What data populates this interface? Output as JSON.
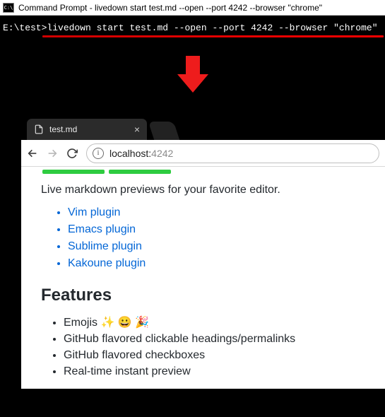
{
  "cmd": {
    "title": "Command Prompt - livedown  start test.md --open --port 4242 --browser \"chrome\"",
    "prompt": "E:\\test>",
    "command": "livedown start test.md --open --port 4242 --browser \"chrome\""
  },
  "browser": {
    "tab_title": "test.md",
    "address_host": "localhost:",
    "address_port": "4242"
  },
  "page": {
    "intro": "Live markdown previews for your favorite editor.",
    "plugins": [
      "Vim plugin",
      "Emacs plugin",
      "Sublime plugin",
      "Kakoune plugin"
    ],
    "features_heading": "Features",
    "features": [
      "Emojis ✨ 😀 🎉",
      "GitHub flavored clickable headings/permalinks",
      "GitHub flavored checkboxes",
      "Real-time instant preview"
    ]
  }
}
